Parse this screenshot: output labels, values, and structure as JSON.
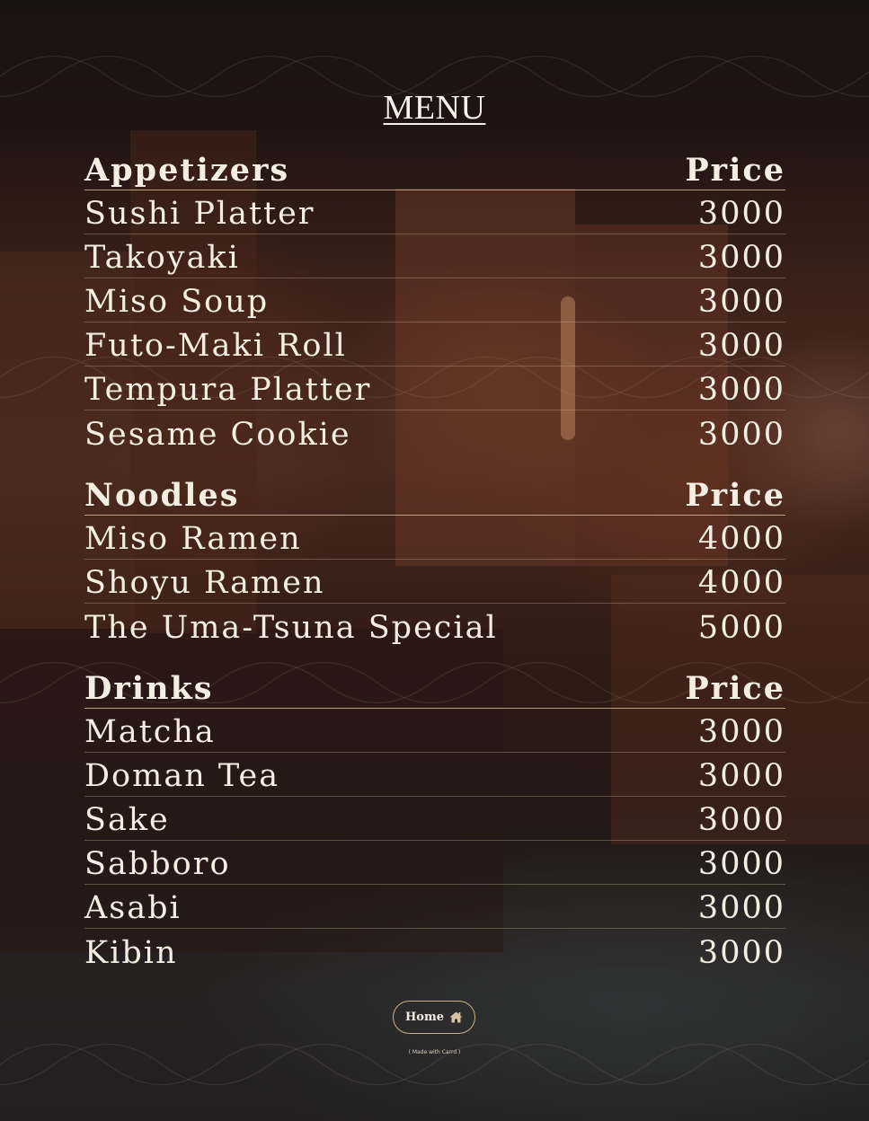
{
  "page": {
    "title": "MENU"
  },
  "sections": [
    {
      "name": "Appetizers",
      "price_header": "Price",
      "items": [
        {
          "name": "Sushi Platter",
          "price": "3000"
        },
        {
          "name": "Takoyaki",
          "price": "3000"
        },
        {
          "name": "Miso Soup",
          "price": "3000"
        },
        {
          "name": "Futo-Maki Roll",
          "price": "3000"
        },
        {
          "name": "Tempura Platter",
          "price": "3000"
        },
        {
          "name": "Sesame Cookie",
          "price": "3000"
        }
      ]
    },
    {
      "name": "Noodles",
      "price_header": "Price",
      "items": [
        {
          "name": "Miso Ramen",
          "price": "4000"
        },
        {
          "name": "Shoyu Ramen",
          "price": "4000"
        },
        {
          "name": "The Uma-Tsuna Special",
          "price": "5000"
        }
      ]
    },
    {
      "name": "Drinks",
      "price_header": "Price",
      "items": [
        {
          "name": "Matcha",
          "price": "3000"
        },
        {
          "name": "Doman Tea",
          "price": "3000"
        },
        {
          "name": "Sake",
          "price": "3000"
        },
        {
          "name": "Sabboro",
          "price": "3000"
        },
        {
          "name": "Asabi",
          "price": "3000"
        },
        {
          "name": "Kibin",
          "price": "3000"
        }
      ]
    }
  ],
  "footer": {
    "home_label": "Home",
    "home_icon": "home-icon",
    "made_with": "( Made with Carrd )"
  },
  "colors": {
    "text": "#f4ede2",
    "accent_border": "#c8b089",
    "background": "#1e1412"
  }
}
